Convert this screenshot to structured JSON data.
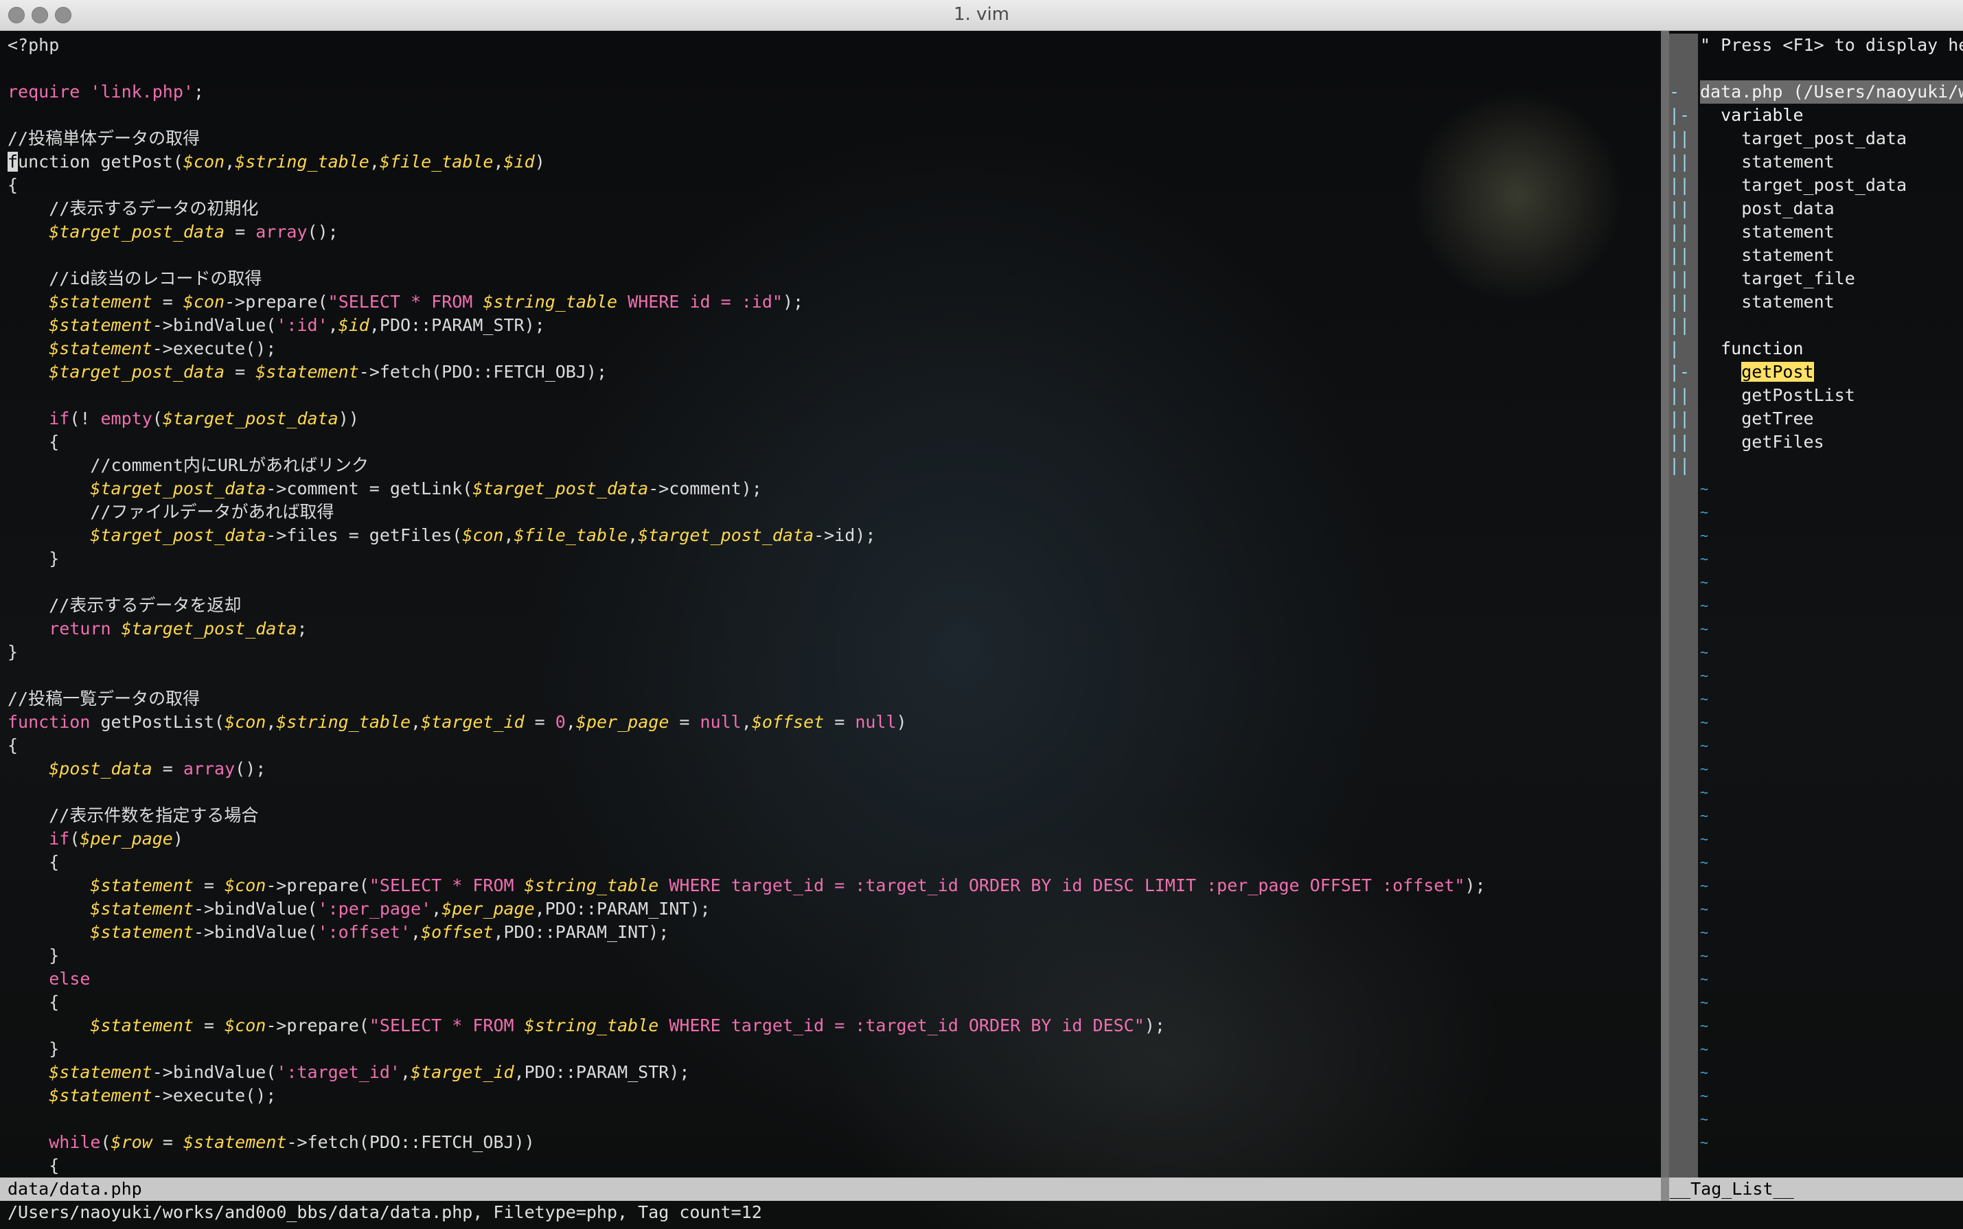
{
  "window": {
    "title": "1. vim"
  },
  "editor_lines": [
    "<?php",
    "",
    "require 'link.php';",
    "",
    "//投稿単体データの取得",
    "function getPost($con,$string_table,$file_table,$id)",
    "{",
    "    //表示するデータの初期化",
    "    $target_post_data = array();",
    "",
    "    //id該当のレコードの取得",
    "    $statement = $con->prepare(\"SELECT * FROM $string_table WHERE id = :id\");",
    "    $statement->bindValue(':id',$id,PDO::PARAM_STR);",
    "    $statement->execute();",
    "    $target_post_data = $statement->fetch(PDO::FETCH_OBJ);",
    "",
    "    if(! empty($target_post_data))",
    "    {",
    "        //comment内にURLがあればリンク",
    "        $target_post_data->comment = getLink($target_post_data->comment);",
    "        //ファイルデータがあれば取得",
    "        $target_post_data->files = getFiles($con,$file_table,$target_post_data->id);",
    "    }",
    "",
    "    //表示するデータを返却",
    "    return $target_post_data;",
    "}",
    "",
    "//投稿一覧データの取得",
    "function getPostList($con,$string_table,$target_id = 0,$per_page = null,$offset = null)",
    "{",
    "    $post_data = array();",
    "",
    "    //表示件数を指定する場合",
    "    if($per_page)",
    "    {",
    "        $statement = $con->prepare(\"SELECT * FROM $string_table WHERE target_id = :target_id ORDER BY id DESC LIMIT :per_page OFFSET :offset\");",
    "        $statement->bindValue(':per_page',$per_page,PDO::PARAM_INT);",
    "        $statement->bindValue(':offset',$offset,PDO::PARAM_INT);",
    "    }",
    "    else",
    "    {",
    "        $statement = $con->prepare(\"SELECT * FROM $string_table WHERE target_id = :target_id ORDER BY id DESC\");",
    "    }",
    "    $statement->bindValue(':target_id',$target_id,PDO::PARAM_STR);",
    "    $statement->execute();",
    "",
    "    while($row = $statement->fetch(PDO::FETCH_OBJ))",
    "    {"
  ],
  "taglist": {
    "help": "\" Press <F1> to display hel",
    "file": "data.php (/Users/naoyuki/wo",
    "kinds": [
      {
        "name": "variable",
        "items": [
          "target_post_data",
          "statement",
          "target_post_data",
          "post_data",
          "statement",
          "statement",
          "target_file",
          "statement"
        ]
      },
      {
        "name": "function",
        "items": [
          "getPost",
          "getPostList",
          "getTree",
          "getFiles"
        ]
      }
    ],
    "highlighted": "getPost",
    "fold_column": [
      "",
      "",
      "-",
      "|-",
      "||",
      "||",
      "||",
      "||",
      "||",
      "||",
      "||",
      "||",
      "||",
      "|",
      "|-",
      "||",
      "||",
      "||",
      "||"
    ],
    "tilde_count": 30
  },
  "statusline": {
    "left": "data/data.php",
    "right": "__Tag_List__"
  },
  "cmdline": "/Users/naoyuki/works/and0o0_bbs/data/data.php, Filetype=php, Tag count=12",
  "colors": {
    "keyword": "#f06fb0",
    "variable": "#ffd84d",
    "tilde": "#3fa0c8",
    "highlight": "#ffe066"
  }
}
